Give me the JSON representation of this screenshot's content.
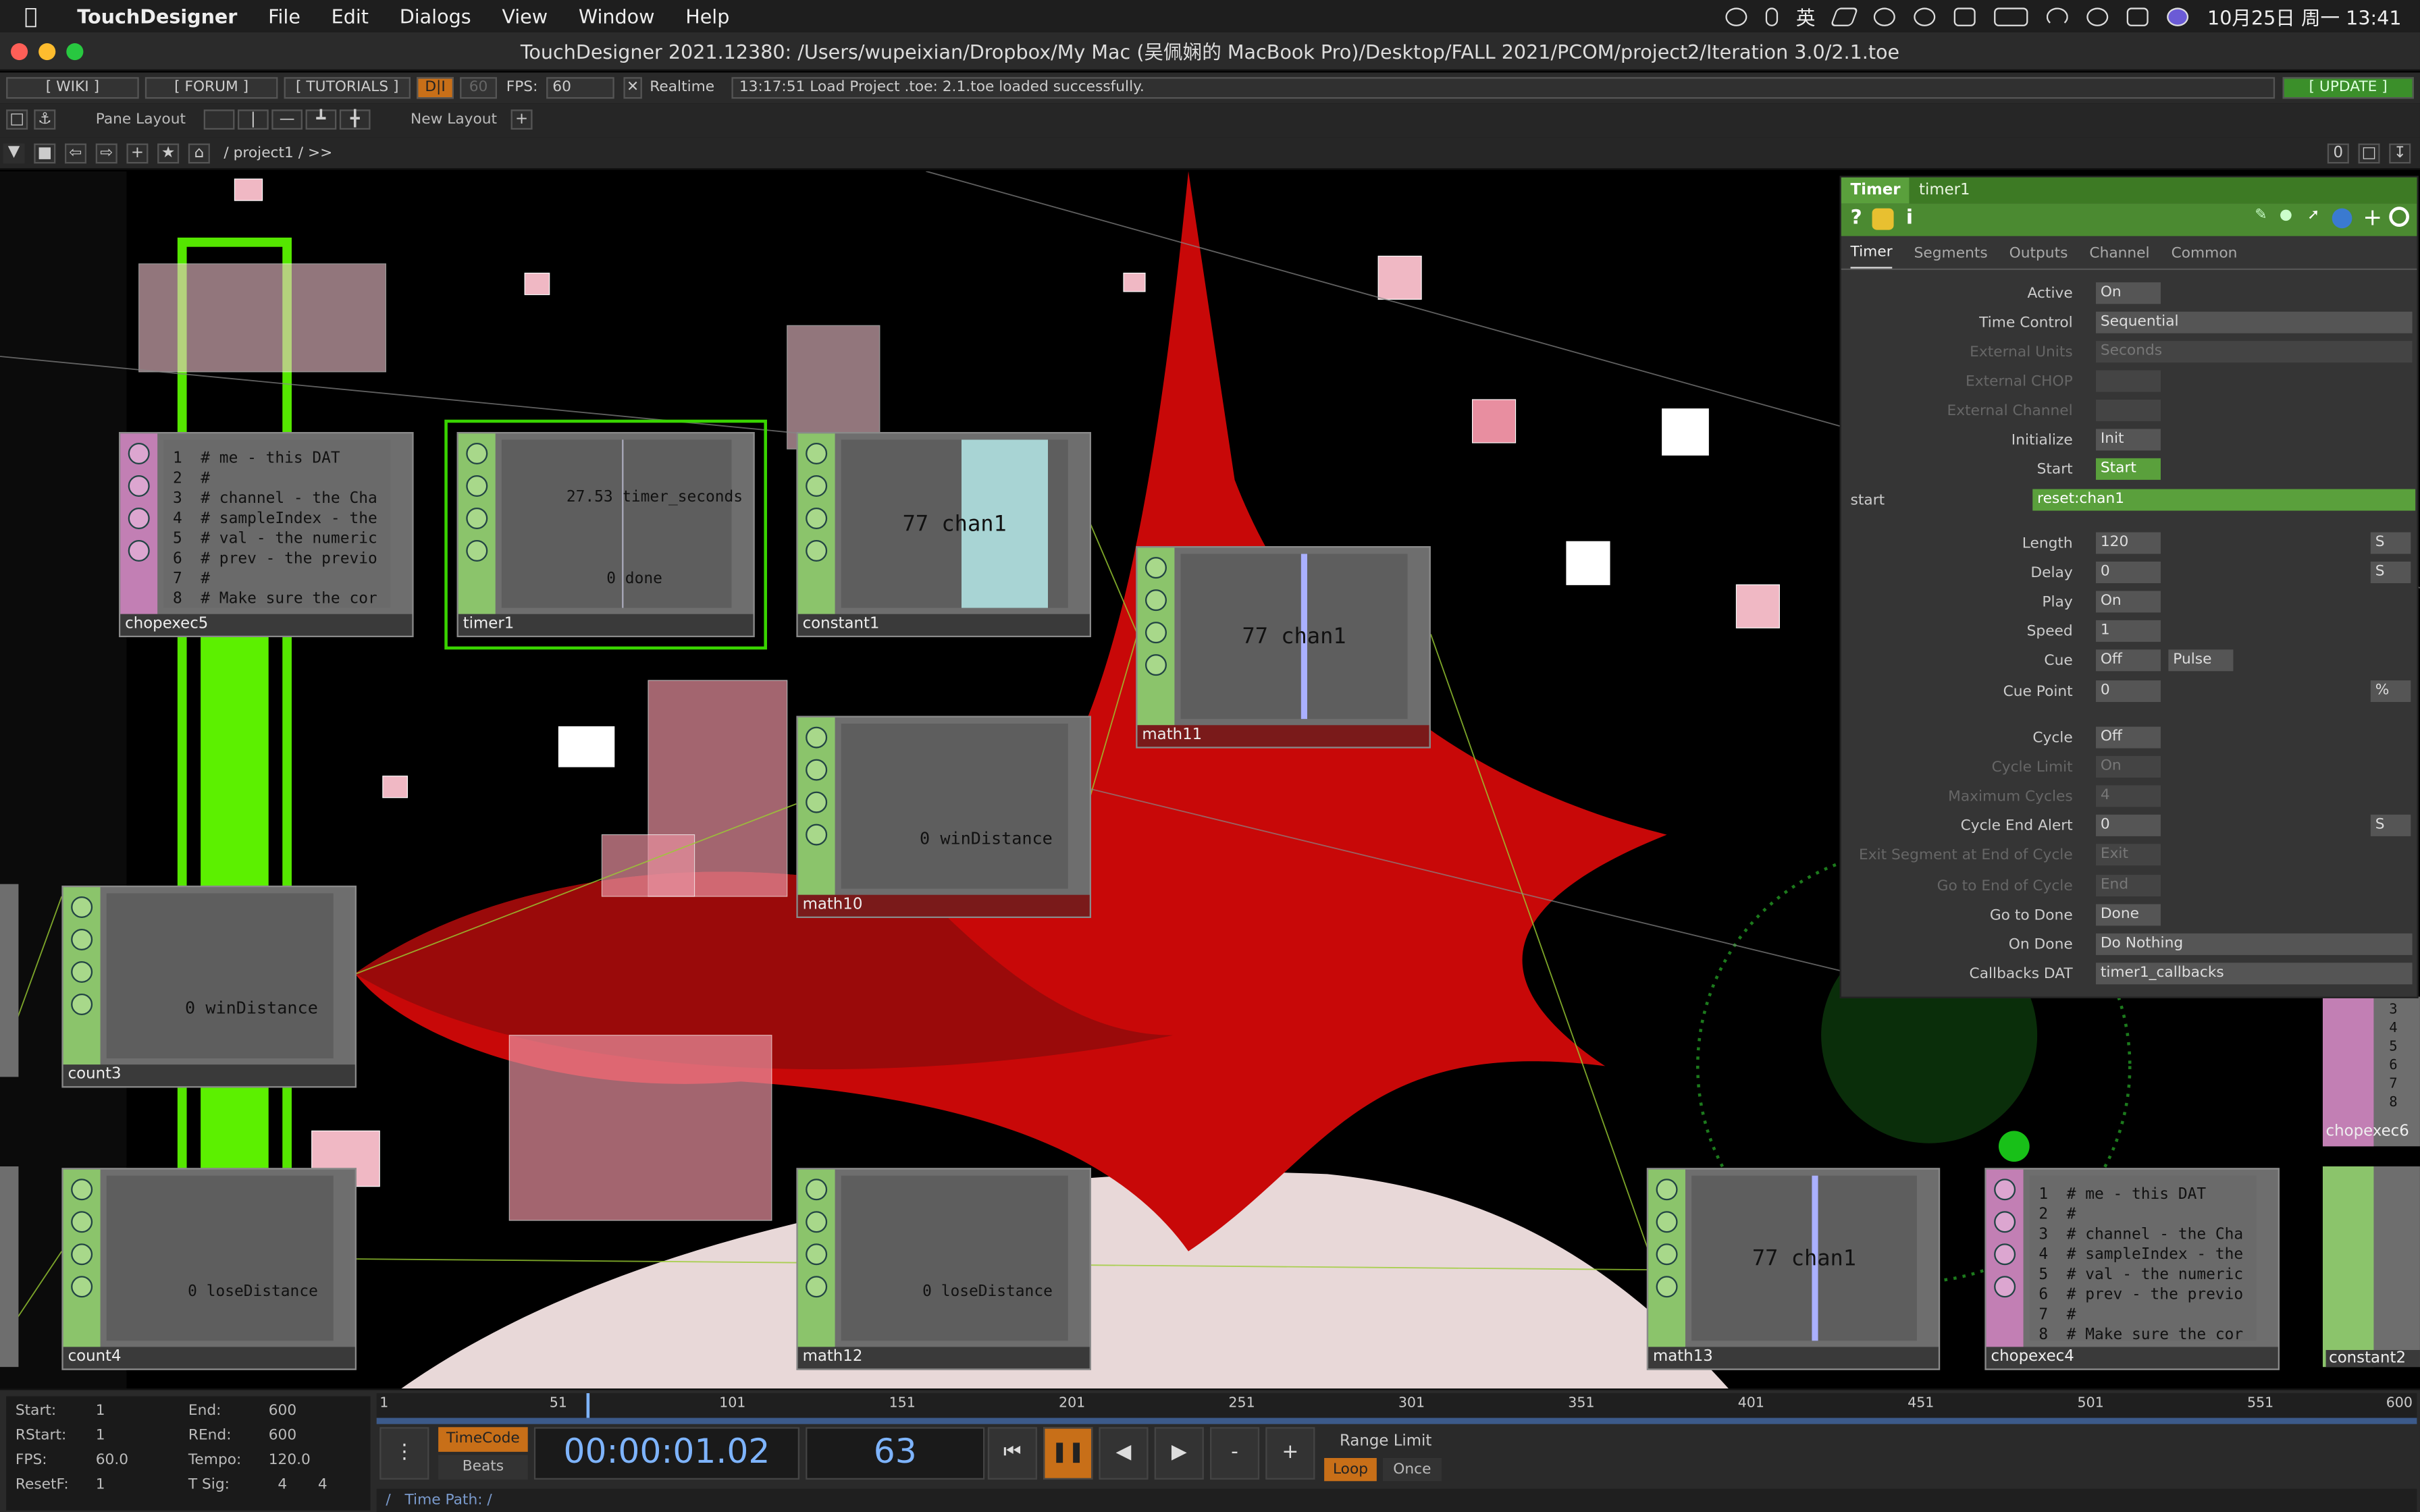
{
  "menubar": {
    "app_name": "TouchDesigner",
    "items": [
      "File",
      "Edit",
      "Dialogs",
      "View",
      "Window",
      "Help"
    ],
    "ime": "英",
    "clock": "10月25日 周一  13:41"
  },
  "window": {
    "title": "TouchDesigner 2021.12380: /Users/wupeixian/Dropbox/My Mac (吴佩娴的 MacBook Pro)/Desktop/FALL 2021/PCOM/project2/Iteration 3.0/2.1.toe"
  },
  "toolbar": {
    "wiki": "[ WIKI ]",
    "forum": "[ FORUM ]",
    "tutorials": "[ TUTORIALS ]",
    "di": "D|I",
    "fps_box": "60",
    "fps_label": "FPS:",
    "fps_value": "60",
    "realtime": "Realtime",
    "status": "13:17:51 Load Project .toe: 2.1.toe loaded successfully.",
    "update": "[ UPDATE ]",
    "pane_layout": "Pane Layout",
    "new_layout": "New Layout",
    "path": "/ project1 / >>",
    "counter": "0"
  },
  "nodes": {
    "chopexec5": {
      "label": "chopexec5",
      "lines": [
        "1  # me - this DAT",
        "2  #",
        "3  # channel - the Cha",
        "4  # sampleIndex - the",
        "5  # val - the numeric",
        "6  # prev - the previo",
        "7  #",
        "8  # Make sure the cor"
      ]
    },
    "timer1": {
      "label": "timer1",
      "seconds": "27.53",
      "seconds_name": "timer_seconds",
      "done": "0 done"
    },
    "constant1": {
      "label": "constant1",
      "value": "77",
      "chan": "chan1"
    },
    "math11": {
      "label": "math11",
      "value": "77",
      "chan": "chan1"
    },
    "math10": {
      "label": "math10",
      "value": "0",
      "chan": "winDistance"
    },
    "count3": {
      "label": "count3",
      "value": "0",
      "chan": "winDistance"
    },
    "count4": {
      "label": "count4",
      "value": "0",
      "chan": "loseDistance"
    },
    "math12": {
      "label": "math12",
      "value": "0",
      "chan": "loseDistance"
    },
    "math13": {
      "label": "math13",
      "value": "77",
      "chan": "chan1"
    },
    "chopexec4": {
      "label": "chopexec4",
      "lines": [
        "1  # me - this DAT",
        "2  #",
        "3  # channel - the Cha",
        "4  # sampleIndex - the",
        "5  # val - the numeric",
        "6  # prev - the previo",
        "7  #",
        "8  # Make sure the cor"
      ]
    },
    "chopexec6": {
      "label": "chopexec6",
      "lines": [
        "3",
        "4",
        "5",
        "6",
        "7",
        "8"
      ]
    },
    "constant2": {
      "label": "constant2"
    }
  },
  "params": {
    "type": "Timer",
    "name": "timer1",
    "tabs": [
      "Timer",
      "Segments",
      "Outputs",
      "Channel",
      "Common"
    ],
    "rows": [
      {
        "label": "Active",
        "value": "On"
      },
      {
        "label": "Time Control",
        "value": "Sequential"
      },
      {
        "label": "External Units",
        "value": "Seconds",
        "dim": true
      },
      {
        "label": "External CHOP",
        "value": "",
        "dim": true
      },
      {
        "label": "External Channel",
        "value": "",
        "dim": true
      },
      {
        "label": "Initialize",
        "value": "Init"
      },
      {
        "label": "Start",
        "value": "Start"
      },
      {
        "label": "start",
        "value": "reset:chan1"
      },
      {
        "label": "Length",
        "value": "120",
        "unit": "S"
      },
      {
        "label": "Delay",
        "value": "0",
        "unit": "S"
      },
      {
        "label": "Play",
        "value": "On"
      },
      {
        "label": "Speed",
        "value": "1"
      },
      {
        "label": "Cue",
        "value": "Off",
        "extra": "Pulse"
      },
      {
        "label": "Cue Point",
        "value": "0",
        "unit": "%"
      },
      {
        "label": "Cycle",
        "value": "Off"
      },
      {
        "label": "Cycle Limit",
        "value": "On",
        "dim": true
      },
      {
        "label": "Maximum Cycles",
        "value": "4",
        "dim": true
      },
      {
        "label": "Cycle End Alert",
        "value": "0",
        "unit": "S"
      },
      {
        "label": "Exit Segment at End of Cycle",
        "value": "Exit",
        "dim": true
      },
      {
        "label": "Go to End of Cycle",
        "value": "End",
        "dim": true
      },
      {
        "label": "Go to Done",
        "value": "Done"
      },
      {
        "label": "On Done",
        "value": "Do Nothing"
      },
      {
        "label": "Callbacks DAT",
        "value": "timer1_callbacks"
      }
    ]
  },
  "timeline": {
    "stats": {
      "start_label": "Start:",
      "start": "1",
      "end_label": "End:",
      "end": "600",
      "rstart_label": "RStart:",
      "rstart": "1",
      "rend_label": "REnd:",
      "rend": "600",
      "fps_label": "FPS:",
      "fps": "60.0",
      "tempo_label": "Tempo:",
      "tempo": "120.0",
      "resetf_label": "ResetF:",
      "resetf": "1",
      "tsig_label": "T Sig:",
      "tsig_a": "4",
      "tsig_b": "4"
    },
    "ruler": [
      "1",
      "51",
      "101",
      "151",
      "201",
      "251",
      "301",
      "351",
      "401",
      "451",
      "501",
      "551",
      "600"
    ],
    "timecode_btn": "TimeCode",
    "beats_btn": "Beats",
    "timecode": "00:00:01.02",
    "frame": "63",
    "range_limit": "Range Limit",
    "loop": "Loop",
    "once": "Once",
    "time_path": "Time Path: /"
  }
}
